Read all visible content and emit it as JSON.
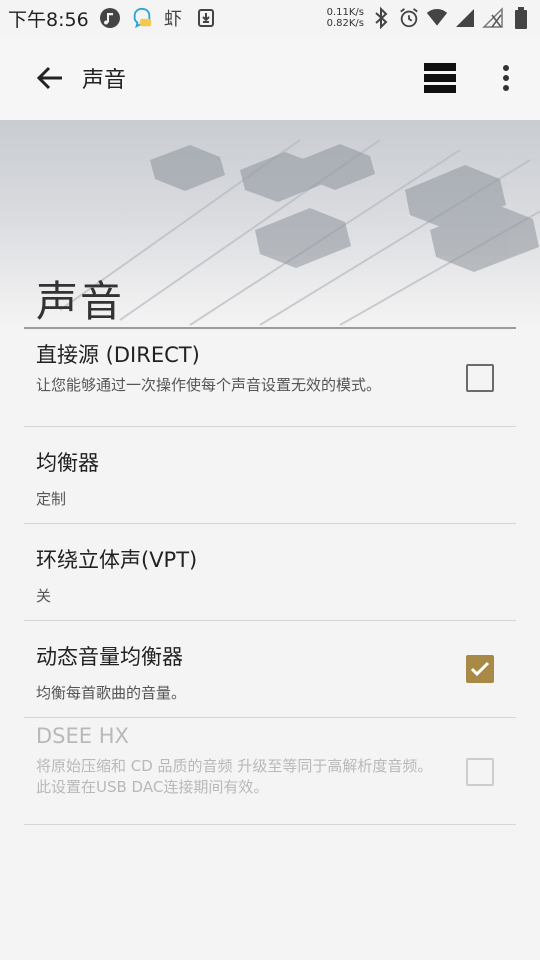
{
  "status_bar": {
    "time": "下午8:56",
    "app_icons": [
      "music-note-icon",
      "chat-bubble-icon",
      "shrimp-app-icon",
      "download-icon"
    ],
    "net_speed_up": "0.11K/s",
    "net_speed_down": "0.82K/s",
    "right_icons": [
      "bluetooth-icon",
      "alarm-icon",
      "wifi-icon",
      "signal-icon",
      "signal-off-icon",
      "battery-icon"
    ]
  },
  "toolbar": {
    "title": "声音",
    "icons": [
      "back-arrow-icon",
      "list-menu-icon",
      "overflow-menu-icon"
    ]
  },
  "header": {
    "title": "声音"
  },
  "settings": [
    {
      "title": "直接源 (DIRECT)",
      "subtitle": "让您能够通过一次操作使每个声音设置无效的模式。",
      "checkbox": "unchecked",
      "enabled": true
    },
    {
      "title": "均衡器",
      "subtitle": "定制",
      "enabled": true
    },
    {
      "title": "环绕立体声(VPT)",
      "subtitle": "关",
      "enabled": true
    },
    {
      "title": "动态音量均衡器",
      "subtitle": "均衡每首歌曲的音量。",
      "checkbox": "checked",
      "enabled": true
    },
    {
      "title": "DSEE HX",
      "subtitle": "将原始压缩和 CD 品质的音频 升级至等同于高解析度音频。",
      "subtitle2": "此设置在USB DAC连接期间有效。",
      "checkbox": "unchecked",
      "enabled": false
    }
  ],
  "colors": {
    "accent_checkbox": "#a88a46",
    "background": "#f4f4f4",
    "divider": "#d6d6d6",
    "disabled_text": "#b9b9b9"
  }
}
